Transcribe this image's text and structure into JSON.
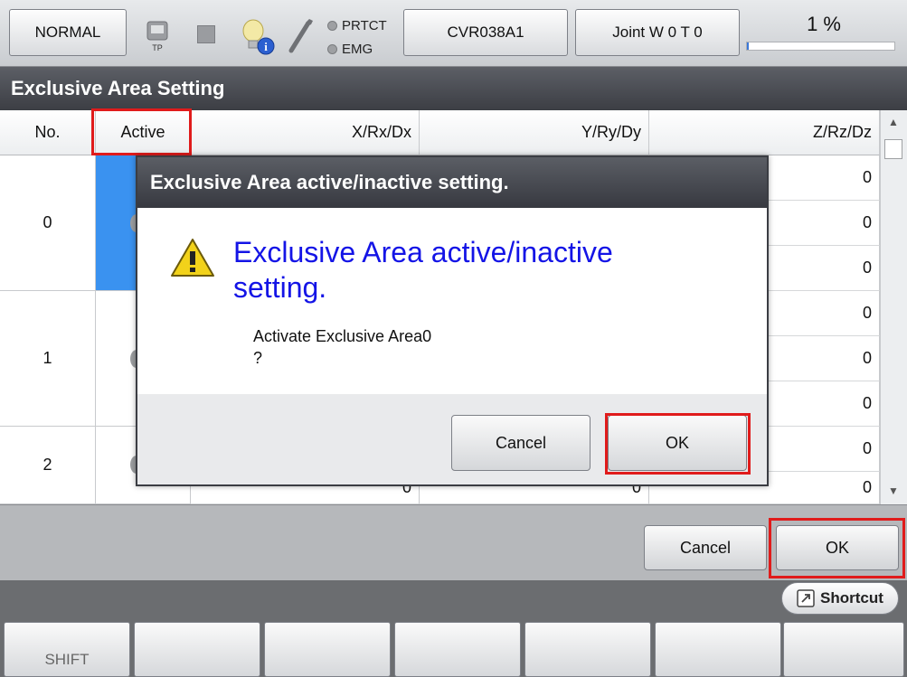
{
  "topbar": {
    "mode_label": "NORMAL",
    "tp_label": "TP",
    "indicators": [
      "PRTCT",
      "EMG"
    ],
    "program_label": "CVR038A1",
    "coord_label": "Joint  W 0 T 0",
    "speed_label": "1 %",
    "speed_fraction": 0.01
  },
  "screen": {
    "title": "Exclusive Area Setting"
  },
  "table": {
    "headers": [
      "No.",
      "Active",
      "X/Rx/Dx",
      "Y/Ry/Dy",
      "Z/Rz/Dz"
    ],
    "areas": [
      {
        "no": "0",
        "active_selected": true
      },
      {
        "no": "1",
        "active_selected": false
      },
      {
        "no": "2",
        "active_selected": false
      }
    ],
    "rows": [
      [
        "0",
        "0",
        "0"
      ],
      [
        "0",
        "0",
        "0"
      ],
      [
        "0",
        "0",
        "0"
      ],
      [
        "0",
        "0",
        "0"
      ],
      [
        "0",
        "0",
        "0"
      ],
      [
        "0",
        "0",
        "0"
      ],
      [
        "0",
        "0",
        "0"
      ],
      [
        "0",
        "0",
        "0"
      ]
    ]
  },
  "dialog": {
    "title": "Exclusive Area active/inactive setting.",
    "heading": "Exclusive Area active/inactive setting.",
    "message_line1": "Activate Exclusive Area0",
    "message_line2": "?",
    "cancel_label": "Cancel",
    "ok_label": "OK"
  },
  "lower_buttons": {
    "cancel_label": "Cancel",
    "ok_label": "OK"
  },
  "shortcut_label": "Shortcut",
  "function_keys": [
    "SHIFT",
    "",
    "",
    "",
    "",
    "",
    ""
  ],
  "colors": {
    "selection": "#3a92f0",
    "highlight_box": "#e01b1b",
    "dialog_heading": "#1414e6",
    "title_bar": "#3c3e44"
  }
}
